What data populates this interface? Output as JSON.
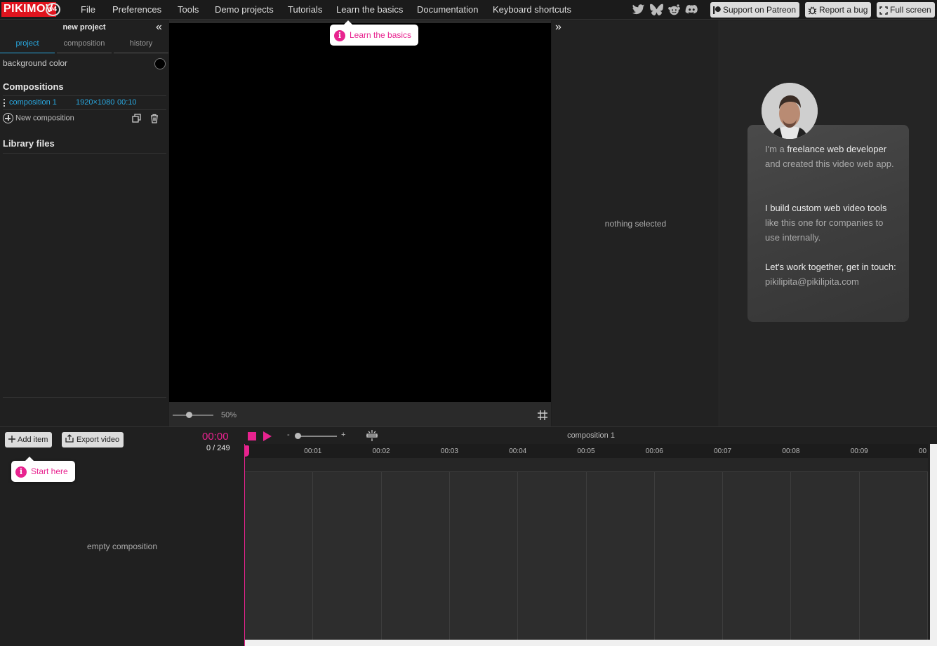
{
  "app": {
    "logo": "PIKIMOV",
    "version": "v4"
  },
  "menu": [
    "File",
    "Preferences",
    "Tools",
    "Demo projects",
    "Tutorials",
    "Learn the basics",
    "Documentation",
    "Keyboard shortcuts"
  ],
  "social": [
    "twitter-icon",
    "bluesky-icon",
    "reddit-icon",
    "discord-icon"
  ],
  "topbar_buttons": {
    "patreon": "Support on Patreon",
    "bug": "Report a bug",
    "fullscreen": "Full screen"
  },
  "left": {
    "project_title": "new project",
    "tabs": [
      "project",
      "composition",
      "history"
    ],
    "background_color_label": "background color",
    "background_color": "#000000",
    "compositions_heading": "Compositions",
    "compositions": [
      {
        "name": "composition 1",
        "size": "1920×1080",
        "duration": "00:10"
      }
    ],
    "new_composition": "New composition",
    "library_heading": "Library files"
  },
  "canvas": {
    "zoom": "50%"
  },
  "properties": {
    "empty": "nothing selected"
  },
  "info": {
    "p1_a": "I'm a ",
    "p1_b": "freelance web developer",
    "p1_c": " and created this video web app.",
    "p2_a": "I build custom web video tools",
    "p2_b": " like this one for companies to use internally.",
    "p3_a": "Let's work together, get in touch:",
    "email": "pikilipita@pikilipita.com"
  },
  "tooltips": {
    "learn": "Learn the basics",
    "start": "Start here"
  },
  "timeline": {
    "add_item": "Add item",
    "export_video": "Export video",
    "time": "00:00",
    "frames": "0 / 249",
    "zoom_minus": "-",
    "zoom_plus": "+",
    "composition_name": "composition 1",
    "ticks": [
      "00:01",
      "00:02",
      "00:03",
      "00:04",
      "00:05",
      "00:06",
      "00:07",
      "00:08",
      "00:09",
      "00"
    ],
    "empty": "empty composition"
  },
  "colors": {
    "accent": "#e8238f",
    "link": "#29a8e0",
    "logo_red": "#e0141e"
  }
}
